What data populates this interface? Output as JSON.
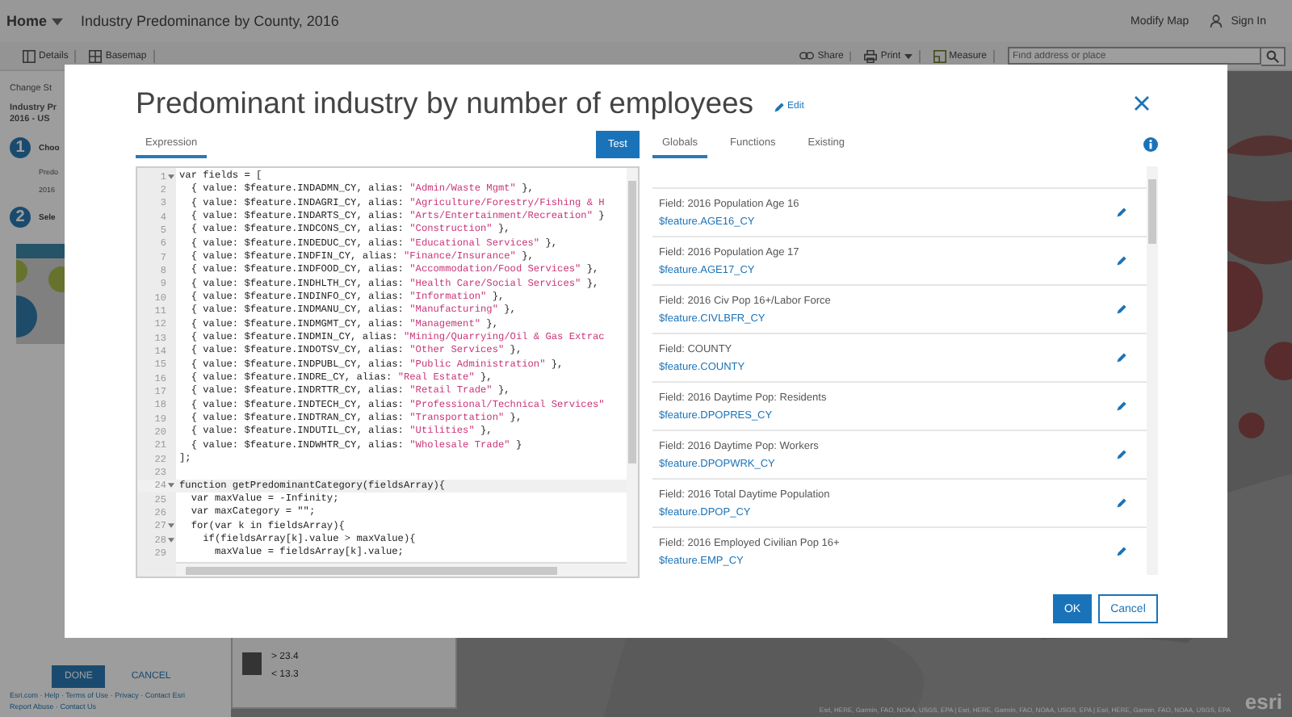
{
  "app_bar": {
    "home": "Home",
    "title": "Industry Predominance by County, 2016",
    "modify": "Modify Map",
    "sign_in": "Sign In"
  },
  "toolbar": {
    "left": [
      {
        "label": "Details",
        "dropdown": false
      },
      {
        "label": "Basemap",
        "dropdown": false
      }
    ],
    "right": [
      {
        "label": "Share",
        "dropdown": false
      },
      {
        "label": "Print",
        "dropdown": true
      },
      {
        "label": "Measure",
        "dropdown": false
      }
    ],
    "search": {
      "placeholder": "Find address or place"
    }
  },
  "side_panel": {
    "heading": "Change St",
    "layer": [
      "Industry Pr",
      "2016 - US"
    ],
    "steps": [
      {
        "number": "1",
        "label": "Choo",
        "lines": [
          "Predo",
          "2016"
        ]
      },
      {
        "number": "2",
        "label": "Sele"
      }
    ],
    "done": "DONE",
    "cancel": "CANCEL",
    "footer": [
      "Esri.com · Help · Terms of Use · Privacy · Contact Esri",
      "Report Abuse · Contact Us"
    ]
  },
  "map": {
    "legend": [
      {
        "label": "> 23.4"
      },
      {
        "label": "< 13.3"
      }
    ],
    "attribution": "Esri, HERE, Garmin, FAO, NOAA, USGS, EPA | Esri, HERE, Garmin, FAO, NOAA, USGS, EPA | Esri, HERE, Garmin, FAO, NOAA, USGS, EPA",
    "logo": "esri"
  },
  "dialog": {
    "title": "Predominant industry by number of employees",
    "edit": "Edit",
    "expression_tab": {
      "label": "Expression",
      "selected": true
    },
    "test": "Test",
    "code_lines": [
      {
        "n": "1",
        "fold": true,
        "active": false,
        "code": "var fields = ["
      },
      {
        "n": "2",
        "fold": false,
        "active": false,
        "code": "  { value: $feature.INDADMN_CY, alias: ",
        "str": "\"Admin/Waste Mgmt\"",
        "tail": " },"
      },
      {
        "n": "3",
        "fold": false,
        "active": false,
        "code": "  { value: $feature.INDAGRI_CY, alias: ",
        "str": "\"Agriculture/Forestry/Fishing & H"
      },
      {
        "n": "4",
        "fold": false,
        "active": false,
        "code": "  { value: $feature.INDARTS_CY, alias: ",
        "str": "\"Arts/Entertainment/Recreation\"",
        "tail": " }"
      },
      {
        "n": "5",
        "fold": false,
        "active": false,
        "code": "  { value: $feature.INDCONS_CY, alias: ",
        "str": "\"Construction\"",
        "tail": " },"
      },
      {
        "n": "6",
        "fold": false,
        "active": false,
        "code": "  { value: $feature.INDEDUC_CY, alias: ",
        "str": "\"Educational Services\"",
        "tail": " },"
      },
      {
        "n": "7",
        "fold": false,
        "active": false,
        "code": "  { value: $feature.INDFIN_CY, alias: ",
        "str": "\"Finance/Insurance\"",
        "tail": " },"
      },
      {
        "n": "8",
        "fold": false,
        "active": false,
        "code": "  { value: $feature.INDFOOD_CY, alias: ",
        "str": "\"Accommodation/Food Services\"",
        "tail": " },"
      },
      {
        "n": "9",
        "fold": false,
        "active": false,
        "code": "  { value: $feature.INDHLTH_CY, alias: ",
        "str": "\"Health Care/Social Services\"",
        "tail": " },"
      },
      {
        "n": "10",
        "fold": false,
        "active": false,
        "code": "  { value: $feature.INDINFO_CY, alias: ",
        "str": "\"Information\"",
        "tail": " },"
      },
      {
        "n": "11",
        "fold": false,
        "active": false,
        "code": "  { value: $feature.INDMANU_CY, alias: ",
        "str": "\"Manufacturing\"",
        "tail": " },"
      },
      {
        "n": "12",
        "fold": false,
        "active": false,
        "code": "  { value: $feature.INDMGMT_CY, alias: ",
        "str": "\"Management\"",
        "tail": " },"
      },
      {
        "n": "13",
        "fold": false,
        "active": false,
        "code": "  { value: $feature.INDMIN_CY, alias: ",
        "str": "\"Mining/Quarrying/Oil & Gas Extrac"
      },
      {
        "n": "14",
        "fold": false,
        "active": false,
        "code": "  { value: $feature.INDOTSV_CY, alias: ",
        "str": "\"Other Services\"",
        "tail": " },"
      },
      {
        "n": "15",
        "fold": false,
        "active": false,
        "code": "  { value: $feature.INDPUBL_CY, alias: ",
        "str": "\"Public Administration\"",
        "tail": " },"
      },
      {
        "n": "16",
        "fold": false,
        "active": false,
        "code": "  { value: $feature.INDRE_CY, alias: ",
        "str": "\"Real Estate\"",
        "tail": " },"
      },
      {
        "n": "17",
        "fold": false,
        "active": false,
        "code": "  { value: $feature.INDRTTR_CY, alias: ",
        "str": "\"Retail Trade\"",
        "tail": " },"
      },
      {
        "n": "18",
        "fold": false,
        "active": false,
        "code": "  { value: $feature.INDTECH_CY, alias: ",
        "str": "\"Professional/Technical Services\""
      },
      {
        "n": "19",
        "fold": false,
        "active": false,
        "code": "  { value: $feature.INDTRAN_CY, alias: ",
        "str": "\"Transportation\"",
        "tail": " },"
      },
      {
        "n": "20",
        "fold": false,
        "active": false,
        "code": "  { value: $feature.INDUTIL_CY, alias: ",
        "str": "\"Utilities\"",
        "tail": " },"
      },
      {
        "n": "21",
        "fold": false,
        "active": false,
        "code": "  { value: $feature.INDWHTR_CY, alias: ",
        "str": "\"Wholesale Trade\"",
        "tail": " }"
      },
      {
        "n": "22",
        "fold": false,
        "active": false,
        "code": "];"
      },
      {
        "n": "23",
        "fold": false,
        "active": false
      },
      {
        "n": "24",
        "fold": true,
        "active": true,
        "code": "function getPredominantCategory(fieldsArray){"
      },
      {
        "n": "25",
        "fold": false,
        "active": false,
        "code": "  var maxValue = -Infinity;"
      },
      {
        "n": "26",
        "fold": false,
        "active": false,
        "code": "  var maxCategory = \"\";"
      },
      {
        "n": "27",
        "fold": true,
        "active": false,
        "code": "  for(var k in fieldsArray){"
      },
      {
        "n": "28",
        "fold": true,
        "active": false,
        "code": "    if(fieldsArray[k].value > maxValue){"
      },
      {
        "n": "29",
        "fold": false,
        "active": false,
        "code": "      maxValue = fieldsArray[k].value;"
      }
    ],
    "tabs": [
      {
        "label": "Globals",
        "selected": true
      },
      {
        "label": "Functions",
        "selected": false
      },
      {
        "label": "Existing",
        "selected": false
      }
    ],
    "fields": [
      {
        "label": "Field: 2016 Population Age 16",
        "name": "$feature.AGE16_CY"
      },
      {
        "label": "Field: 2016 Population Age 17",
        "name": "$feature.AGE17_CY"
      },
      {
        "label": "Field: 2016 Civ Pop 16+/Labor Force",
        "name": "$feature.CIVLBFR_CY"
      },
      {
        "label": "Field: COUNTY",
        "name": "$feature.COUNTY"
      },
      {
        "label": "Field: 2016 Daytime Pop: Residents",
        "name": "$feature.DPOPRES_CY"
      },
      {
        "label": "Field: 2016 Daytime Pop: Workers",
        "name": "$feature.DPOPWRK_CY"
      },
      {
        "label": "Field: 2016 Total Daytime Population",
        "name": "$feature.DPOP_CY"
      },
      {
        "label": "Field: 2016 Employed Civilian Pop 16+",
        "name": "$feature.EMP_CY"
      }
    ],
    "ok": "OK",
    "cancel": "Cancel"
  }
}
